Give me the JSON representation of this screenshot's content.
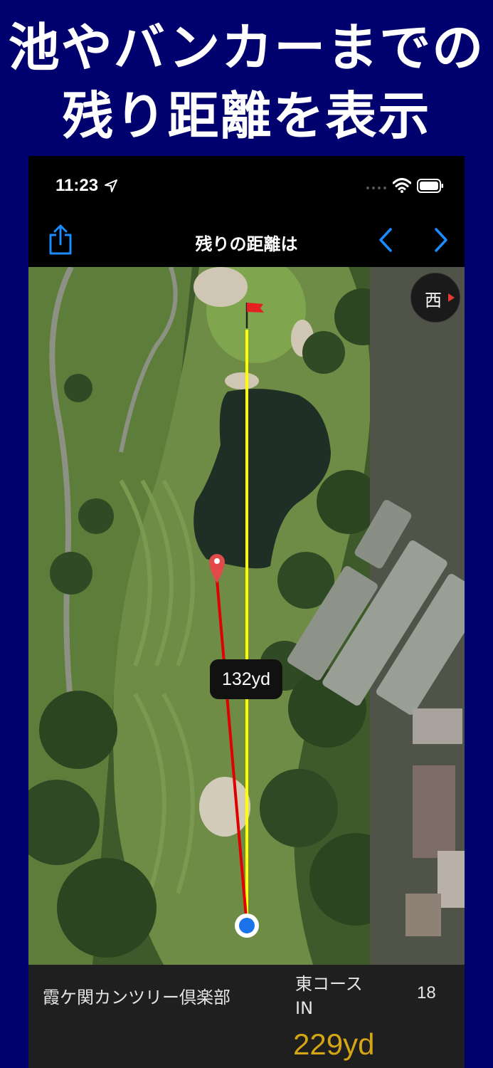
{
  "headline": {
    "line1": "池やバンカーまでの",
    "line2": "残り距離を表示"
  },
  "status_bar": {
    "time": "11:23"
  },
  "nav": {
    "title": "残りの距離は",
    "share_icon": "share-icon",
    "prev_icon": "chevron-left-icon",
    "next_icon": "chevron-right-icon",
    "accent": "#1a8cff"
  },
  "map": {
    "compass_label": "西",
    "distance_label": "132yd",
    "flag_color": "#e52020",
    "target_line_color": "#ffff00",
    "marker_line_color": "#e00000",
    "user_dot_color": "#1a73e8"
  },
  "info": {
    "club_name": "霞ケ関カンツリー倶楽部",
    "course_line1": "東コース",
    "course_line2": "IN",
    "hole_number": "18",
    "remaining_distance": "229yd",
    "remaining_color": "#d4a514"
  }
}
